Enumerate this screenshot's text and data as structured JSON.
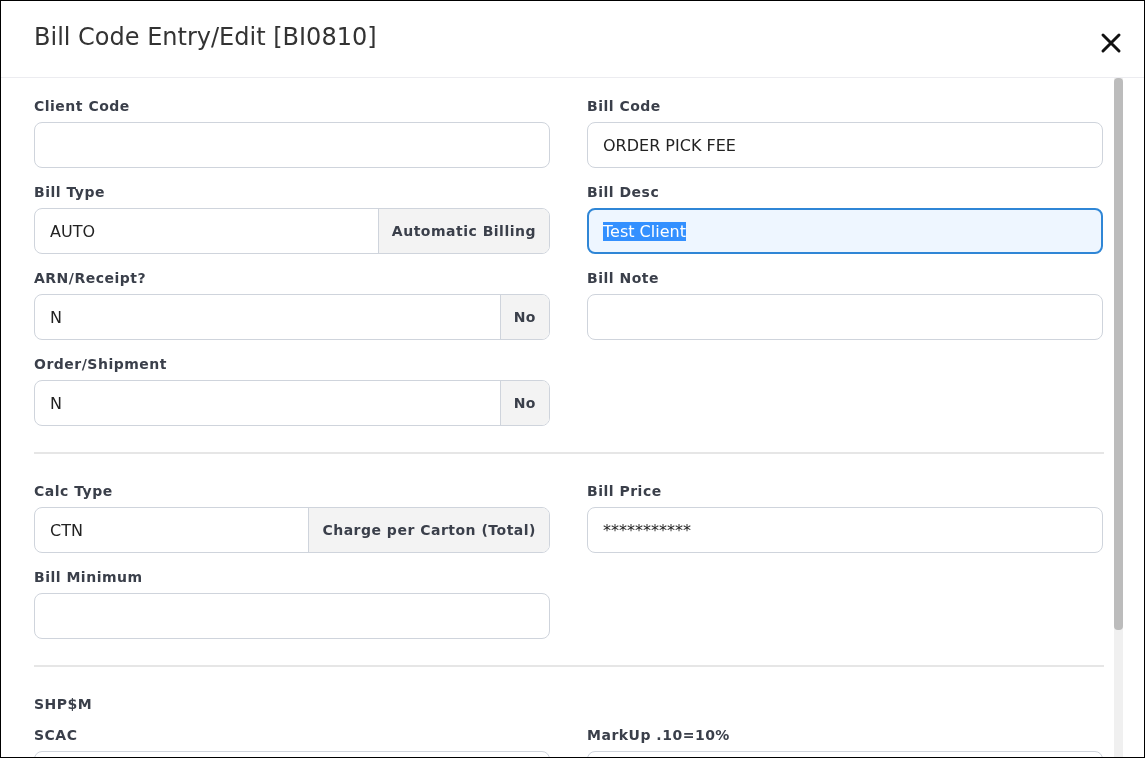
{
  "window": {
    "title": "Bill Code Entry/Edit [BI0810]"
  },
  "sections": [
    {
      "left": [
        {
          "label": "Client Code"
        },
        {
          "label": "Bill Type",
          "value": "AUTO",
          "addon": "Automatic Billing"
        },
        {
          "label": "ARN/Receipt?",
          "value": "N",
          "addon": "No"
        },
        {
          "label": "Order/Shipment",
          "value": "N",
          "addon": "No"
        }
      ],
      "right": [
        {
          "label": "Bill Code",
          "value": "ORDER PICK FEE"
        },
        {
          "label": "Bill Desc",
          "value": "Test Client",
          "focused": true,
          "text_selected": true
        },
        {
          "label": "Bill Note"
        }
      ]
    },
    {
      "left": [
        {
          "label": "Calc Type",
          "value": "CTN",
          "addon": "Charge per Carton (Total)"
        },
        {
          "label": "Bill Minimum"
        }
      ],
      "right": [
        {
          "label": "Bill Price",
          "value": "***********"
        }
      ]
    },
    {
      "heading": "SHP$M",
      "left": [
        {
          "label": "SCAC"
        }
      ],
      "right": [
        {
          "label": "MarkUp .10=10%"
        }
      ]
    }
  ]
}
